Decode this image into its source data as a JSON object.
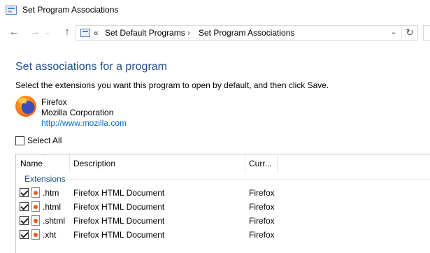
{
  "window": {
    "title": "Set Program Associations"
  },
  "nav": {
    "back_glyph": "←",
    "forward_glyph": "→",
    "recent_glyph": "⌄",
    "up_glyph": "↑"
  },
  "address": {
    "overflow": "«",
    "crumbs": [
      "Set Default Programs",
      "Set Program Associations"
    ],
    "separator": "›",
    "dropdown_glyph": "⌄",
    "refresh_glyph": "↻"
  },
  "page": {
    "heading": "Set associations for a program",
    "instructions": "Select the extensions you want this program to open by default, and then click Save."
  },
  "program": {
    "name": "Firefox",
    "company": "Mozilla Corporation",
    "url": "http://www.mozilla.com"
  },
  "select_all": {
    "label": "Select All",
    "checked": false
  },
  "list": {
    "columns": [
      "Name",
      "Description",
      "Curr..."
    ],
    "sort_glyph": "^",
    "group": "Extensions",
    "rows": [
      {
        "ext": ".htm",
        "description": "Firefox HTML Document",
        "current": "Firefox",
        "checked": true
      },
      {
        "ext": ".html",
        "description": "Firefox HTML Document",
        "current": "Firefox",
        "checked": true
      },
      {
        "ext": ".shtml",
        "description": "Firefox HTML Document",
        "current": "Firefox",
        "checked": true
      },
      {
        "ext": ".xht",
        "description": "Firefox HTML Document",
        "current": "Firefox",
        "checked": true
      }
    ]
  },
  "colors": {
    "heading": "#1e4f91",
    "link": "#0066cc"
  }
}
